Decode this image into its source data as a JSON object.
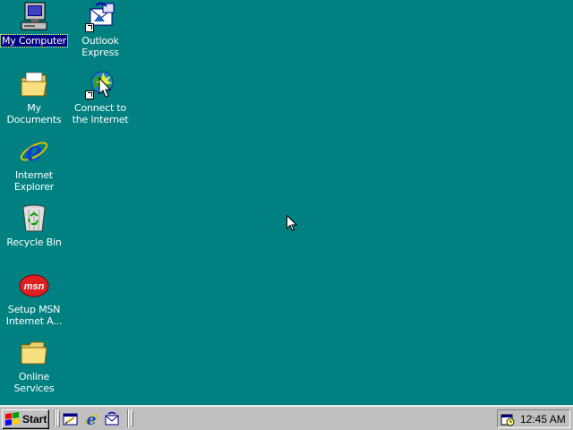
{
  "desktop": {
    "background_color": "#008080",
    "icons": [
      {
        "label": "My Computer",
        "icon": "my-computer-icon",
        "selected": true
      },
      {
        "label": "Outlook Express",
        "icon": "outlook-express-icon"
      },
      {
        "label": "My Documents",
        "icon": "my-documents-icon"
      },
      {
        "label": "Connect to the Internet",
        "icon": "connect-internet-icon"
      },
      {
        "label": "Internet Explorer",
        "icon": "internet-explorer-icon"
      },
      {
        "label": "Recycle Bin",
        "icon": "recycle-bin-icon"
      },
      {
        "label": "Setup MSN Internet A...",
        "icon": "msn-icon"
      },
      {
        "label": "Online Services",
        "icon": "folder-icon"
      }
    ]
  },
  "taskbar": {
    "start_label": "Start",
    "quick_launch": [
      {
        "icon": "show-desktop-icon"
      },
      {
        "icon": "internet-explorer-icon"
      },
      {
        "icon": "outlook-express-icon"
      }
    ],
    "tray": {
      "icon": "scheduler-icon",
      "clock": "12:45 AM"
    }
  }
}
